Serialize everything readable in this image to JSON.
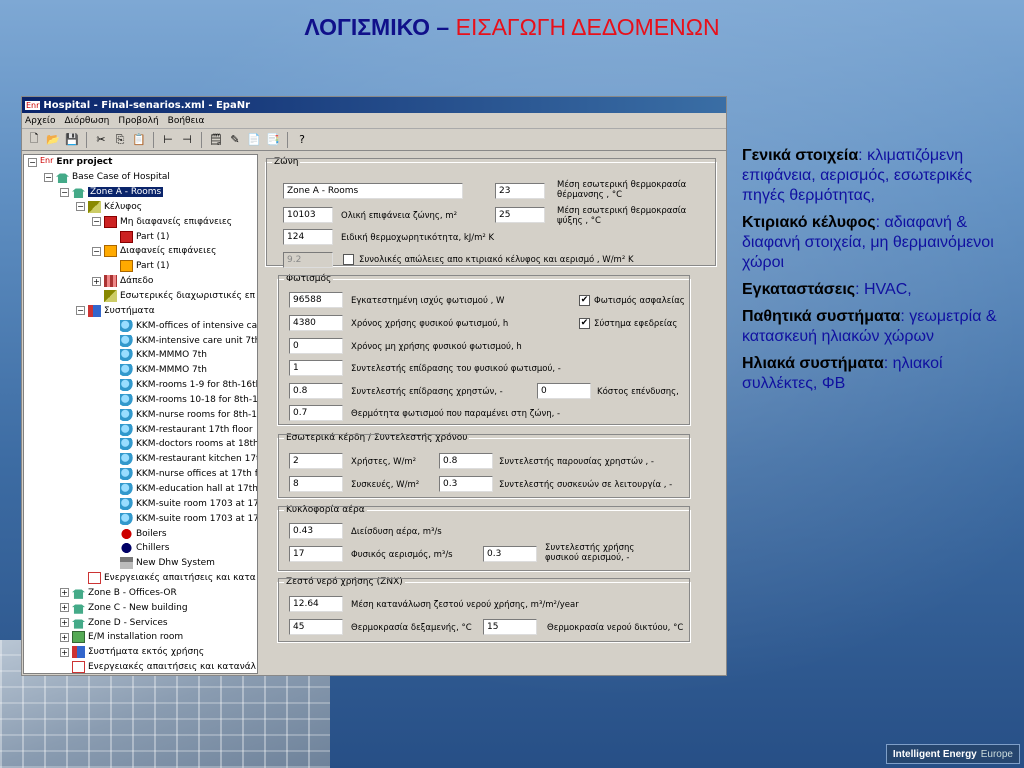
{
  "slide": {
    "title_part1": "ΛΟΓΙΣΜΙΚΟ –",
    "title_part2": "ΕΙΣΑΓΩΓΗ ΔΕΔΟΜΕΝΩΝ",
    "footer_brand": "Intelligent Energy",
    "footer_region": "Europe"
  },
  "window": {
    "app_icon": "Enr",
    "title": "Hospital - Final-senarios.xml - EpaNr",
    "menu": [
      "Αρχείο",
      "Διόρθωση",
      "Προβολή",
      "Βοήθεια"
    ],
    "toolbar_icons": [
      "new-icon",
      "open-icon",
      "save-icon",
      "cut-icon",
      "copy-icon",
      "paste-icon",
      "align-left-icon",
      "align-right-icon",
      "note-icon",
      "edit-icon",
      "report-icon",
      "report2-icon",
      "help-icon"
    ]
  },
  "tree": [
    {
      "text": "Enr project",
      "expander": "−",
      "icon": "enr",
      "indent": 0,
      "bold": true
    },
    {
      "text": "Base Case of Hospital",
      "expander": "−",
      "icon": "house",
      "indent": 1
    },
    {
      "text": "Zone A - Rooms",
      "expander": "−",
      "icon": "house",
      "indent": 2,
      "selected": true
    },
    {
      "text": "Κέλυφος",
      "expander": "−",
      "icon": "shell",
      "indent": 3
    },
    {
      "text": "Μη διαφανείς επιφάνειες",
      "expander": "−",
      "icon": "red",
      "indent": 4
    },
    {
      "text": "Part (1)",
      "expander": "",
      "icon": "red",
      "indent": 5
    },
    {
      "text": "Διαφανείς επιφάνειες",
      "expander": "−",
      "icon": "win",
      "indent": 4
    },
    {
      "text": "Part (1)",
      "expander": "",
      "icon": "win",
      "indent": 5
    },
    {
      "text": "Δάπεδο",
      "expander": "+",
      "icon": "floor",
      "indent": 4
    },
    {
      "text": "Εσωτερικές διαχωριστικές επ",
      "expander": "",
      "icon": "shell",
      "indent": 4
    },
    {
      "text": "Συστήματα",
      "expander": "−",
      "icon": "sys",
      "indent": 3
    },
    {
      "text": "KKM-offices of intensive car",
      "expander": "",
      "icon": "globe",
      "indent": 5
    },
    {
      "text": "KKM-intensive care unit 7th",
      "expander": "",
      "icon": "globe",
      "indent": 5
    },
    {
      "text": "KKM-MMMO 7th",
      "expander": "",
      "icon": "globe",
      "indent": 5
    },
    {
      "text": "KKM-MMMO 7th",
      "expander": "",
      "icon": "globe",
      "indent": 5
    },
    {
      "text": "KKM-rooms 1-9 for 8th-16th",
      "expander": "",
      "icon": "globe",
      "indent": 5
    },
    {
      "text": "KKM-rooms 10-18 for 8th-16",
      "expander": "",
      "icon": "globe",
      "indent": 5
    },
    {
      "text": "KKM-nurse rooms for 8th-16",
      "expander": "",
      "icon": "globe",
      "indent": 5
    },
    {
      "text": "KKM-restaurant 17th floor",
      "expander": "",
      "icon": "globe",
      "indent": 5
    },
    {
      "text": "KKM-doctors rooms at 18th",
      "expander": "",
      "icon": "globe",
      "indent": 5
    },
    {
      "text": "KKM-restaurant kitchen 17th",
      "expander": "",
      "icon": "globe",
      "indent": 5
    },
    {
      "text": "KKM-nurse offices at 17th fl",
      "expander": "",
      "icon": "globe",
      "indent": 5
    },
    {
      "text": "KKM-education hall at 17th f",
      "expander": "",
      "icon": "globe",
      "indent": 5
    },
    {
      "text": "KKM-suite room 1703 at 17t",
      "expander": "",
      "icon": "globe",
      "indent": 5
    },
    {
      "text": "KKM-suite room 1703 at 17t",
      "expander": "",
      "icon": "globe",
      "indent": 5
    },
    {
      "text": "Boilers",
      "expander": "",
      "icon": "boiler",
      "indent": 5
    },
    {
      "text": "Chillers",
      "expander": "",
      "icon": "chiller",
      "indent": 5
    },
    {
      "text": "New Dhw System",
      "expander": "",
      "icon": "tap",
      "indent": 5
    },
    {
      "text": "Ενεργειακές απαιτήσεις και κατα",
      "expander": "",
      "icon": "doc",
      "indent": 3
    },
    {
      "text": "Zone B - Offices-OR",
      "expander": "+",
      "icon": "house",
      "indent": 2
    },
    {
      "text": "Zone C - New building",
      "expander": "+",
      "icon": "house",
      "indent": 2
    },
    {
      "text": "Zone D - Services",
      "expander": "+",
      "icon": "house",
      "indent": 2
    },
    {
      "text": "E/M installation room",
      "expander": "+",
      "icon": "box",
      "indent": 2
    },
    {
      "text": "Συστήματα εκτός χρήσης",
      "expander": "+",
      "icon": "sys",
      "indent": 2
    },
    {
      "text": "Ενεργειακές απαιτήσεις και κατανάλ",
      "expander": "",
      "icon": "doc",
      "indent": 2
    }
  ],
  "form": {
    "zone": {
      "legend": "Ζώνη",
      "name": "Zone A - Rooms",
      "heat_temp": "23",
      "heat_temp_label": "Μέση εσωτερική θερμοκρασία θέρμανσης , °C",
      "area": "10103",
      "area_label": "Ολική επιφάνεια ζώνης, m²",
      "cool_temp": "25",
      "cool_temp_label": "Μέση εσωτερική θερμοκρασία ψύξης , °C",
      "heat_cap": "124",
      "heat_cap_label": "Ειδική θερμοχωρητικότητα, kJ/m² K",
      "losses": "9.2",
      "losses_label": "Συνολικές απώλειες απο κτιριακό κέλυφος και αερισμό , W/m² K"
    },
    "lighting": {
      "legend": "Φωτισμός",
      "power": "96588",
      "power_label": "Εγκατεστημένη ισχύς φωτισμού , W",
      "safety_label": "Φωτισμός ασφαλείας",
      "safety_checked": "✔",
      "hours_natural": "4380",
      "hours_natural_label": "Χρόνος χρήσης φυσικού φωτισμού, h",
      "backup_label": "Σύστημα εφεδρείας",
      "backup_checked": "✔",
      "hours_non_natural": "0",
      "hours_non_natural_label": "Χρόνος μη χρήσης φυσικού φωτισμού, h",
      "factor": "1",
      "factor_label": "Συντελεστής επίδρασης του φυσικού φωτισμού, -",
      "user_factor": "0.8",
      "user_factor_label": "Συντελεστής επίδρασης χρηστών, -",
      "invest": "0",
      "invest_label": "Κόστος επένδυσης,",
      "heat_remain": "0.7",
      "heat_remain_label": "Θερμότητα φωτισμού που παραμένει στη ζώνη, -"
    },
    "gains": {
      "legend": "Εσωτερικά κέρδη / Συντελεστής χρόνου",
      "users": "2",
      "users_label": "Χρήστες, W/m²",
      "users_presence": "0.8",
      "users_presence_label": "Συντελεστής παρουσίας χρηστών , -",
      "devices": "8",
      "devices_label": "Συσκευές, W/m²",
      "devices_operation": "0.3",
      "devices_operation_label": "Συντελεστής συσκευών σε λειτουργία , -"
    },
    "air": {
      "legend": "Κυκλοφορία αέρα",
      "infiltration": "0.43",
      "infiltration_label": "Διείσδυση αέρα, m³/s",
      "natural_vent": "17",
      "natural_vent_label": "Φυσικός αερισμός, m³/s",
      "usage_factor": "0.3",
      "usage_factor_label": "Συντελεστής χρήσης φυσικού αερισμού, -"
    },
    "dhw": {
      "legend": "Ζεστό νερό χρήσης (ΖΝΧ)",
      "consumption": "12.64",
      "consumption_label": "Μέση κατανάλωση ζεστού νερού χρήσης, m³/m²/year",
      "tank_temp": "45",
      "tank_temp_label": "Θερμοκρασία δεξαμενής, °C",
      "net_temp": "15",
      "net_temp_label": "Θερμοκρασία νερού δικτύου, °C"
    }
  },
  "side": [
    {
      "head": "Γενικά στοιχεία",
      "body": ": κλιματιζόμενη επιφάνεια, αερισμός, εσωτερικές πηγές θερμότητας,"
    },
    {
      "head": "Κτιριακό κέλυφος",
      "body": ": αδιαφανή & διαφανή στοιχεία, μη θερμαινόμενοι χώροι"
    },
    {
      "head": "Εγκαταστάσεις",
      "body": ": HVAC,"
    },
    {
      "head": "Παθητικά συστήματα",
      "body": ": γεωμετρία & κατασκευή ηλιακών χώρων"
    },
    {
      "head": "Ηλιακά συστήματα",
      "body": ": ηλιακοί συλλέκτες, ΦΒ"
    }
  ],
  "colors": {
    "title_blue": "#10108a",
    "title_red": "#e8101a",
    "side_text": "#1010a0",
    "selection": "#0a246a"
  }
}
